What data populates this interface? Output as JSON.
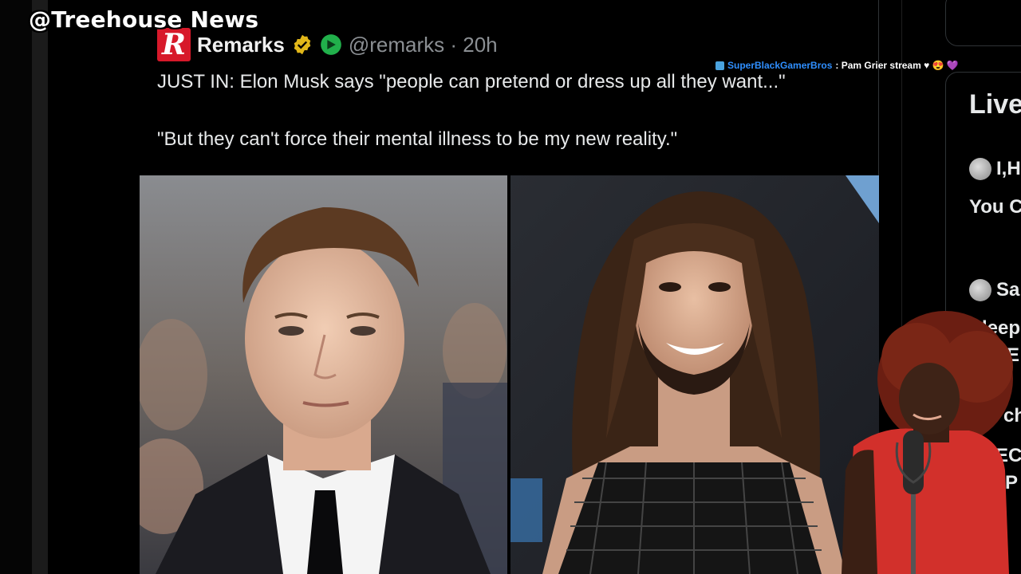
{
  "watermark": "@Treehouse News",
  "tweet": {
    "logo_letter": "R",
    "display_name": "Remarks",
    "handle_time": "@remarks · 20h",
    "line1": "JUST IN: Elon Musk says \"people can pretend or dress up all they want...\"",
    "line2": "\"But they can't force their mental illness to be my new reality.\""
  },
  "overlay_chat": {
    "username": "SuperBlackGamerBros",
    "message": ": Pam Grier stream ♥ 😍  💜"
  },
  "live_panel": {
    "title": "Live",
    "rows": [
      {
        "name": "I,H",
        "text": "You C"
      },
      {
        "name": "Sa",
        "text": "Sleep"
      }
    ],
    "fragments": [
      "E",
      "ch",
      "PEC",
      "MP"
    ]
  },
  "colors": {
    "background": "#000000",
    "logo_red": "#d7192a",
    "verified_gold": "#e2b719",
    "badge_green": "#21b04b",
    "handle_grey": "#8b8f93",
    "chat_user_blue": "#2f8fff"
  }
}
